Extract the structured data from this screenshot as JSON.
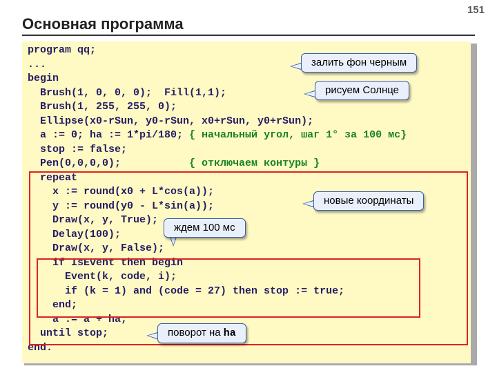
{
  "page_number": "151",
  "title": "Основная программа",
  "code": {
    "l1": "program qq;",
    "l2": "...",
    "l3": "begin",
    "l4": "  Brush(1, 0, 0, 0);  Fill(1,1);",
    "l5": "  Brush(1, 255, 255, 0);",
    "l6": "  Ellipse(x0-rSun, y0-rSun, x0+rSun, y0+rSun);",
    "l7a": "  a := 0; ha := 1*pi/180; ",
    "l7b": "{ начальный угол, шаг 1° за 100 мс}",
    "l8": "  stop := false;",
    "l9a": "  Pen(0,0,0,0);           ",
    "l9b": "{ отключаем контуры }",
    "l10": "  repeat",
    "l11": "    x := round(x0 + L*cos(a));",
    "l12": "    y := round(y0 - L*sin(a));",
    "l13": "    Draw(x, y, True);",
    "l14": "    Delay(100);",
    "l15": "    Draw(x, y, False);",
    "l16": "    if IsEvent then begin",
    "l17": "      Event(k, code, i);",
    "l18": "      if (k = 1) and (code = 27) then stop := true;",
    "l19": "    end;",
    "l20": "    a := a + ha;",
    "l21": "  until stop;",
    "l22": "end."
  },
  "callouts": {
    "fill_black": "залить фон черным",
    "draw_sun": "рисуем Солнце",
    "new_coords": "новые координаты",
    "wait_100ms": "ждем 100 мс",
    "rotate_prefix": "поворот на ",
    "rotate_code": "ha"
  }
}
